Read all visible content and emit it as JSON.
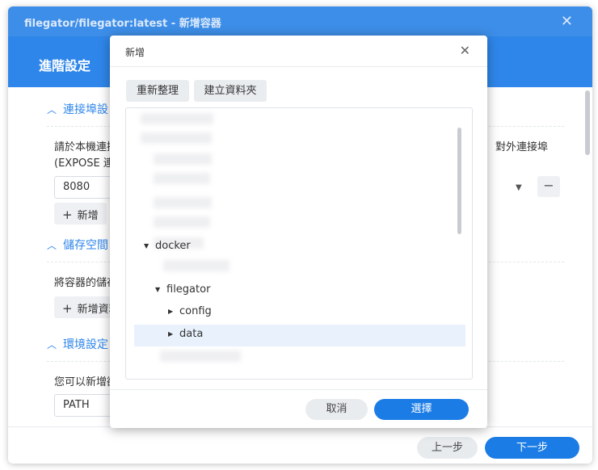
{
  "background_window": {
    "title": "filegator/filegator:latest - 新增容器",
    "header": "進階設定",
    "sections": [
      {
        "title": "連接埠設",
        "text_line1": "請於本機連接埠",
        "text_line2": "(EXPOSE 連接",
        "input_value": "8080",
        "add_label": "新增",
        "right_text": "對外連接埠"
      },
      {
        "title": "儲存空間",
        "text_line1": "將容器的儲存空",
        "add_label": "新增資料"
      },
      {
        "title": "環境設定",
        "text_line1": "您可以新增欲",
        "input_value": "PATH"
      }
    ],
    "prev_label": "上一步",
    "next_label": "下一步"
  },
  "modal": {
    "title": "新增",
    "refresh_label": "重新整理",
    "new_folder_label": "建立資料夾",
    "tree": [
      {
        "label": "docker",
        "expanded": true
      },
      {
        "label": "filegator",
        "expanded": true
      },
      {
        "label": "config",
        "expanded": false
      },
      {
        "label": "data",
        "expanded": false,
        "selected": true
      }
    ],
    "cancel_label": "取消",
    "select_label": "選擇"
  },
  "colors": {
    "accent": "#1b7ce6",
    "header_blue": "#2f86ea",
    "title_blue": "#3d8ee8",
    "selected_row": "#e8f1fc"
  }
}
